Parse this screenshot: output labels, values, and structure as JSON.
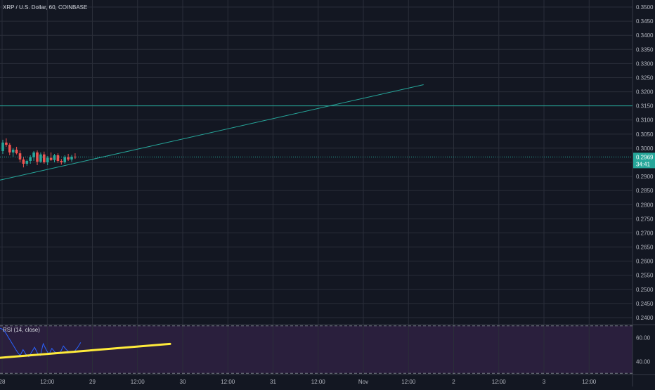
{
  "colors": {
    "background": "#131722",
    "grid": "#2a2e39",
    "axis_text": "#b2b5be",
    "up_candle": "#26a69a",
    "down_candle": "#ef5350",
    "trend_line": "#26a69a",
    "horizontal_line": "#26a69a",
    "rsi_line": "#2962ff",
    "rsi_band": "#2a1f3d",
    "rsi_trend": "#ffeb3b",
    "price_label_bg": "#26a69a"
  },
  "legend": {
    "title": "XRP / U.S. Dollar, 60, COINBASE"
  },
  "rsi_legend": {
    "title": "RSI (14, close)"
  },
  "price_label": {
    "price": "0.2969",
    "countdown": "34:41"
  },
  "chart_data": [
    {
      "type": "candlestick",
      "title": "XRP / U.S. Dollar, 60, COINBASE",
      "ylim": [
        0.2375,
        0.3525
      ],
      "y_ticks": [
        "0.3500",
        "0.3450",
        "0.3400",
        "0.3350",
        "0.3300",
        "0.3250",
        "0.3200",
        "0.3150",
        "0.3100",
        "0.3050",
        "0.3000",
        "0.2950",
        "0.2900",
        "0.2850",
        "0.2800",
        "0.2750",
        "0.2700",
        "0.2650",
        "0.2600",
        "0.2550",
        "0.2500",
        "0.2450",
        "0.2400"
      ],
      "x_ticks": [
        "28",
        "12:00",
        "29",
        "12:00",
        "30",
        "12:00",
        "31",
        "12:00",
        "Nov",
        "12:00",
        "2",
        "12:00",
        "3",
        "12:00"
      ],
      "last_price": 0.2969,
      "horizontal_line": 0.315,
      "trend_line": {
        "from": [
          0.0,
          0.2887
        ],
        "to": [
          123.0,
          0.3225
        ]
      },
      "candles": [
        {
          "o": 0.299,
          "h": 0.303,
          "l": 0.298,
          "c": 0.302
        },
        {
          "o": 0.302,
          "h": 0.3035,
          "l": 0.3005,
          "c": 0.3012
        },
        {
          "o": 0.3012,
          "h": 0.3018,
          "l": 0.2975,
          "c": 0.2985
        },
        {
          "o": 0.2985,
          "h": 0.3,
          "l": 0.297,
          "c": 0.2995
        },
        {
          "o": 0.2995,
          "h": 0.3005,
          "l": 0.2978,
          "c": 0.2982
        },
        {
          "o": 0.2982,
          "h": 0.2992,
          "l": 0.295,
          "c": 0.296
        },
        {
          "o": 0.296,
          "h": 0.2968,
          "l": 0.2932,
          "c": 0.2945
        },
        {
          "o": 0.2945,
          "h": 0.296,
          "l": 0.2938,
          "c": 0.2955
        },
        {
          "o": 0.2955,
          "h": 0.2975,
          "l": 0.2945,
          "c": 0.2968
        },
        {
          "o": 0.2968,
          "h": 0.299,
          "l": 0.2955,
          "c": 0.2985
        },
        {
          "o": 0.2985,
          "h": 0.2992,
          "l": 0.294,
          "c": 0.2952
        },
        {
          "o": 0.2952,
          "h": 0.2985,
          "l": 0.2948,
          "c": 0.2978
        },
        {
          "o": 0.2978,
          "h": 0.2988,
          "l": 0.2945,
          "c": 0.295
        },
        {
          "o": 0.295,
          "h": 0.2972,
          "l": 0.294,
          "c": 0.2966
        },
        {
          "o": 0.2966,
          "h": 0.2985,
          "l": 0.2955,
          "c": 0.2958
        },
        {
          "o": 0.2958,
          "h": 0.298,
          "l": 0.295,
          "c": 0.2975
        },
        {
          "o": 0.2975,
          "h": 0.2982,
          "l": 0.2948,
          "c": 0.2955
        },
        {
          "o": 0.2955,
          "h": 0.2962,
          "l": 0.2942,
          "c": 0.295
        },
        {
          "o": 0.295,
          "h": 0.2975,
          "l": 0.2945,
          "c": 0.2968
        },
        {
          "o": 0.2968,
          "h": 0.298,
          "l": 0.2955,
          "c": 0.296
        },
        {
          "o": 0.296,
          "h": 0.2976,
          "l": 0.2952,
          "c": 0.297
        },
        {
          "o": 0.297,
          "h": 0.2982,
          "l": 0.2962,
          "c": 0.2969
        }
      ]
    },
    {
      "type": "line",
      "title": "RSI (14, close)",
      "ylim": [
        29,
        71
      ],
      "y_ticks": [
        "60.00",
        "40.00"
      ],
      "bands": [
        30,
        70
      ],
      "values": [
        68,
        67,
        64,
        60,
        56,
        52,
        48,
        45,
        50,
        46,
        44,
        48,
        52,
        47,
        45,
        55,
        50,
        46,
        51,
        48,
        47,
        48,
        53,
        50,
        48,
        48,
        49,
        52,
        56
      ],
      "trend_line": {
        "from": [
          0.0,
          43.1
        ],
        "to": [
          242.0,
          54.8
        ]
      }
    }
  ]
}
